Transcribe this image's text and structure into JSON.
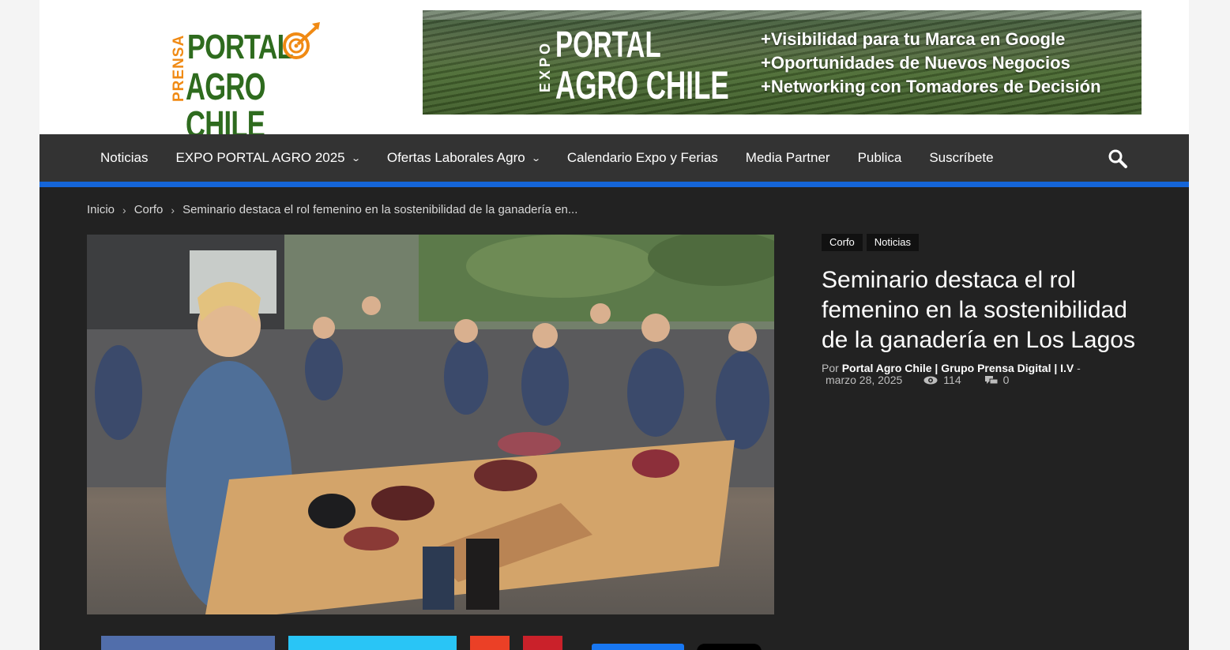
{
  "logo": {
    "prensa": "PRENSA",
    "line1": "PORTAL",
    "line2": "AGRO CHILE"
  },
  "banner": {
    "expo": "EXPO",
    "line1": "PORTAL",
    "line2": "AGRO CHILE",
    "bullets": [
      "+Visibilidad para tu Marca en Google",
      "+Oportunidades de Nuevos Negocios",
      "+Networking con Tomadores de Decisión"
    ]
  },
  "nav": {
    "items": [
      {
        "label": "Noticias",
        "dropdown": false
      },
      {
        "label": "EXPO PORTAL AGRO 2025",
        "dropdown": true
      },
      {
        "label": "Ofertas Laborales Agro",
        "dropdown": true
      },
      {
        "label": "Calendario Expo y Ferias",
        "dropdown": false
      },
      {
        "label": "Media Partner",
        "dropdown": false
      },
      {
        "label": "Publica",
        "dropdown": false
      },
      {
        "label": "Suscríbete",
        "dropdown": false
      }
    ],
    "search_icon": "search-icon",
    "accent_color": "#1565d8"
  },
  "breadcrumb": {
    "items": [
      "Inicio",
      "Corfo",
      "Seminario destaca el rol femenino en la sostenibilidad de la ganadería en..."
    ],
    "separator": "›"
  },
  "article": {
    "categories": [
      "Corfo",
      "Noticias"
    ],
    "title": "Seminario destaca el rol femenino en la sostenibilidad de la ganadería en Los Lagos",
    "by_label": "Por",
    "author": "Portal Agro Chile | Grupo Prensa Digital | I.V",
    "dash": "-",
    "date": "marzo 28, 2025",
    "views": "114",
    "comments": "0"
  },
  "share": {
    "colors": {
      "facebook": "#516eab",
      "twitter": "#29c5f6",
      "google": "#eb4026",
      "pinterest": "#ca212a"
    }
  }
}
